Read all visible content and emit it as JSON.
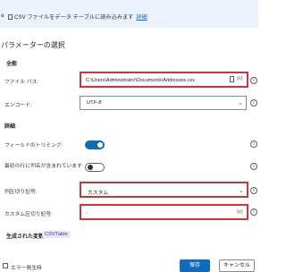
{
  "banner": {
    "icon": "csv-file-icon",
    "text": "CSV ファイルをデータ テーブルに読み込みます",
    "link": "詳細"
  },
  "section_title": "パラメーターの選択",
  "general": {
    "title": "全般",
    "file_path_label": "ファイル パス:",
    "file_path_value": "C:\\Users\\Administrator\\Documents\\Addresses.csv",
    "file_icon": "file-icon",
    "var_icon": "{x}",
    "encoding_label": "エンコード:",
    "encoding_value": "UTF-8"
  },
  "details": {
    "title": "詳細",
    "trim_label": "フィールドのトリミング:",
    "trim_on": true,
    "header_label": "最初の行に列名が含まれています:",
    "header_on": false,
    "separator_label": "列区切り記号:",
    "separator_value": "カスタム",
    "custom_sep_label": "カスタム区切り記号:",
    "custom_sep_value": ",",
    "var_icon": "{x}"
  },
  "generated": {
    "label": "生成された変数",
    "variable": "CSVTable"
  },
  "footer": {
    "error_handling": "エラー発生時",
    "save": "保存",
    "cancel": "キャンセル"
  },
  "colors": {
    "accent": "#0f6cbd",
    "highlight": "#d13438",
    "banner_bg": "#eaf3fb"
  }
}
